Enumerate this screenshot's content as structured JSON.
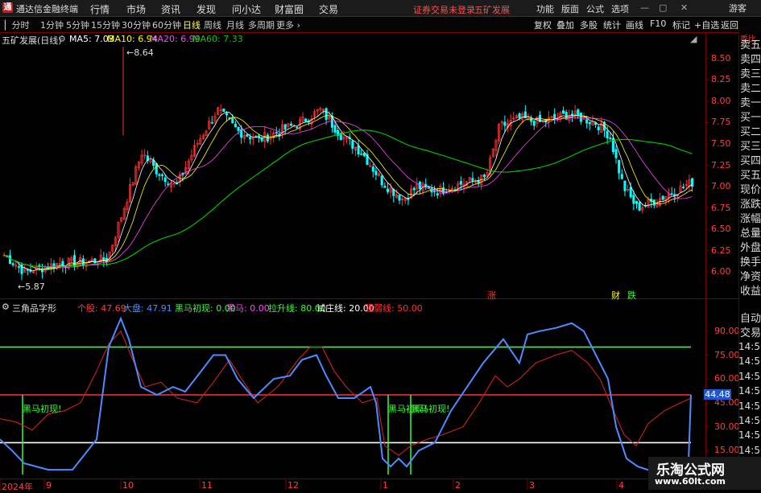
{
  "titlebar": {
    "app_title": "通达信金融终端",
    "logo": "通",
    "menus": [
      "行情",
      "市场",
      "资讯",
      "发现",
      "问小达",
      "财富圈",
      "交易"
    ],
    "warning": "证券交易未登录",
    "stock": "五矿发展",
    "right_menus": [
      "功能",
      "版面",
      "公式",
      "选项"
    ],
    "guest": "游客"
  },
  "toolbar": {
    "periods": [
      "分时",
      "1分钟",
      "5分钟",
      "15分钟",
      "30分钟",
      "60分钟",
      "日线",
      "周线",
      "月线",
      "多周期",
      "更多"
    ],
    "active_period": "日线",
    "right_buttons": [
      "复权",
      "叠加",
      "多股",
      "统计",
      "画线",
      "F10",
      "标记",
      "+自选",
      "返回"
    ]
  },
  "main_chart": {
    "title": "五矿发展(日线)",
    "ma_labels": [
      "MA5: 7.03",
      "MA10: 6.94",
      "MA20: 6.99",
      "MA60: 7.33"
    ],
    "ma_colors": [
      "#ffffff",
      "#ffff00",
      "#ff44ff",
      "#00cc00"
    ],
    "y_ticks": [
      "8.50",
      "8.25",
      "8.00",
      "7.75",
      "7.50",
      "7.25",
      "7.00",
      "6.75",
      "6.50",
      "6.25",
      "6.00"
    ],
    "y_values": [
      8.5,
      8.25,
      8.0,
      7.75,
      7.5,
      7.25,
      7.0,
      6.75,
      6.5,
      6.25,
      6.0
    ],
    "high_label": "8.64",
    "low_label": "5.87",
    "markers": [
      "涨",
      "财",
      "跌"
    ]
  },
  "indicator": {
    "title": "三角品字形",
    "labels": [
      {
        "text": "个股: 47.69",
        "color": "#ff4040"
      },
      {
        "text": "大盘: 47.91",
        "color": "#4d8cff"
      },
      {
        "text": "黑马初现: 0.00",
        "color": "#33ff33"
      },
      {
        "text": "黑马: 0.00",
        "color": "#ff44ff"
      },
      {
        "text": "拉升线: 80.00",
        "color": "#33ff33"
      },
      {
        "text": "试庄线: 20.00",
        "color": "#ffffff"
      },
      {
        "text": "强弱线: 50.00",
        "color": "#ff3030"
      }
    ],
    "y_ticks": [
      "90.00",
      "75.00",
      "60.00",
      "45.00",
      "30.00",
      "15.00"
    ],
    "current": "44.48",
    "signal_text": [
      "黑马初现!",
      "黑马初现!",
      "黑马初现!"
    ]
  },
  "x_axis": [
    "2024年",
    "9",
    "10",
    "11",
    "12",
    "1",
    "2",
    "3",
    "4"
  ],
  "side_panel": {
    "top_label": "委比",
    "items": [
      "卖五",
      "卖四",
      "卖三",
      "卖二",
      "卖一",
      "买一",
      "买二",
      "买三",
      "买四",
      "买五",
      "现价",
      "涨跌",
      "涨幅",
      "总量",
      "外盘",
      "换手",
      "净资",
      "收益"
    ],
    "lower": [
      "自动",
      "交易"
    ],
    "times": [
      "14:56",
      "14:56",
      "14:56",
      "14:56",
      "14:56",
      "14:56",
      "14:56",
      "14:56"
    ]
  },
  "watermark": {
    "line1": "乐淘公式网",
    "line2": "www.60lt.com"
  },
  "colors": {
    "up": "#ff3030",
    "down": "#00ffff",
    "background": "#000000",
    "grid": "#7a0000"
  }
}
